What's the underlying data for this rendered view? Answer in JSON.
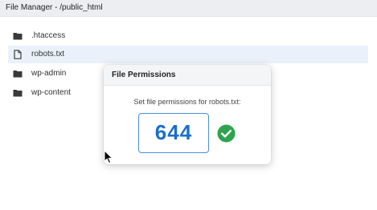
{
  "window": {
    "title": "File Manager - /public_html"
  },
  "files": [
    {
      "name": ".htaccess",
      "icon": "folder-icon"
    },
    {
      "name": "robots.txt",
      "icon": "file-icon",
      "selected": true
    },
    {
      "name": "wp-admin",
      "icon": "folder-icon"
    },
    {
      "name": "wp-content",
      "icon": "folder-icon"
    }
  ],
  "dialog": {
    "title": "File Permissions",
    "prompt": "Set file permissions for robots.txt:",
    "permission_value": "644",
    "status_icon": "check-circle-icon",
    "accent": "#1a6fc9",
    "success": "#2ea44f"
  }
}
